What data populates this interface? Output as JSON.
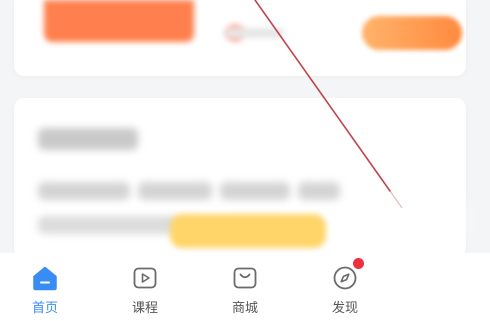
{
  "colors": {
    "accent": "#3a8cf5",
    "badge": "#ee2f3c",
    "promo_orange": "#ff7a45",
    "cta_yellow": "#ffd56a",
    "scratch": "#b3262e"
  },
  "tabbar": {
    "active": "home",
    "items": [
      {
        "id": "home",
        "label": "首页",
        "icon": "home-icon"
      },
      {
        "id": "courses",
        "label": "课程",
        "icon": "play-icon"
      },
      {
        "id": "mall",
        "label": "商城",
        "icon": "shopping-bag-icon"
      },
      {
        "id": "discover",
        "label": "发现",
        "icon": "compass-icon",
        "has_badge": true
      }
    ]
  }
}
